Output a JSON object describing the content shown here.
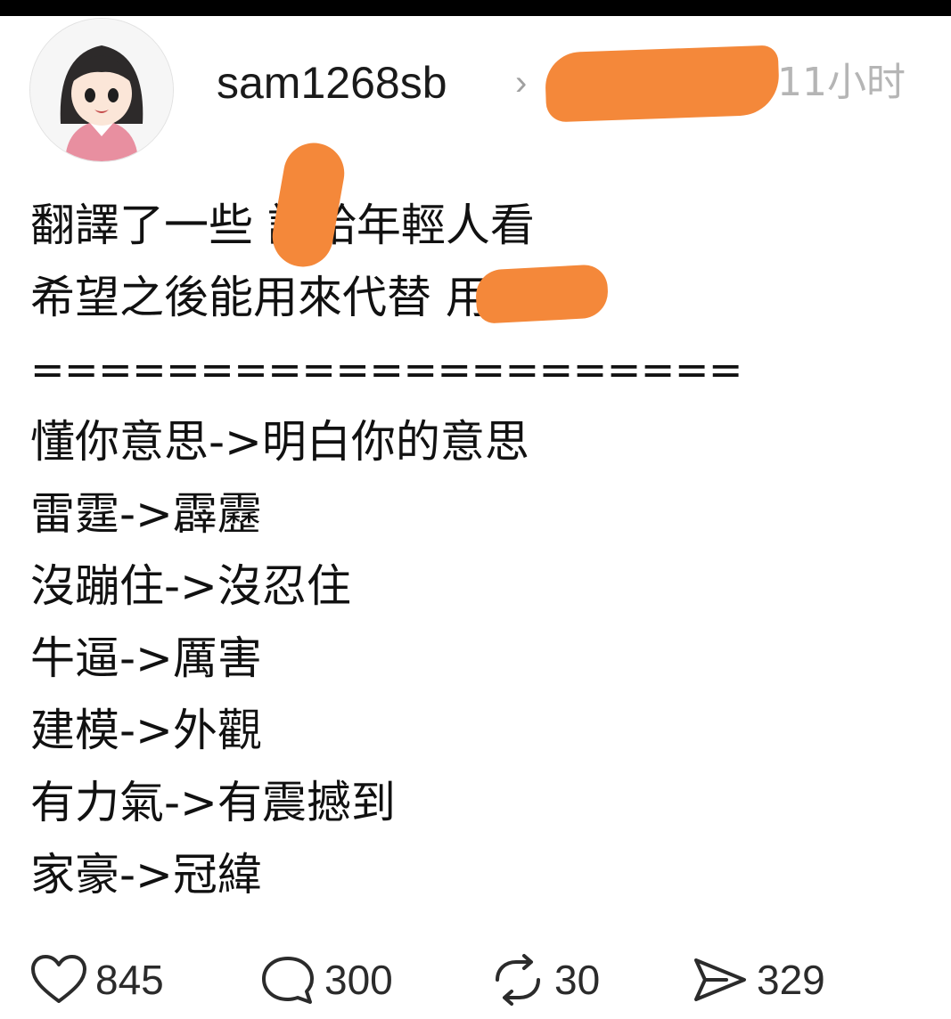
{
  "status_bar": {},
  "post": {
    "author": {
      "username": "sam1268sb",
      "chevron": "›"
    },
    "timestamp": "11小时",
    "lines": [
      "翻譯了一些 語給年輕人看",
      "希望之後能用來代替 用語",
      "=====================",
      "懂你意思->明白你的意思",
      "雷霆->霹靂",
      "沒蹦住->沒忍住",
      "牛逼->厲害",
      "建模->外觀",
      "有力氣->有震撼到",
      "家豪->冠緯"
    ],
    "actions": {
      "likes": "845",
      "replies": "300",
      "reposts": "30",
      "shares": "329"
    }
  },
  "icons": {
    "like": "heart-icon",
    "reply": "speech-bubble-icon",
    "repost": "repost-arrows-icon",
    "share": "send-icon"
  },
  "colors": {
    "redaction": "#f4883a",
    "text": "#111111",
    "timestamp": "#b5b5b5"
  }
}
